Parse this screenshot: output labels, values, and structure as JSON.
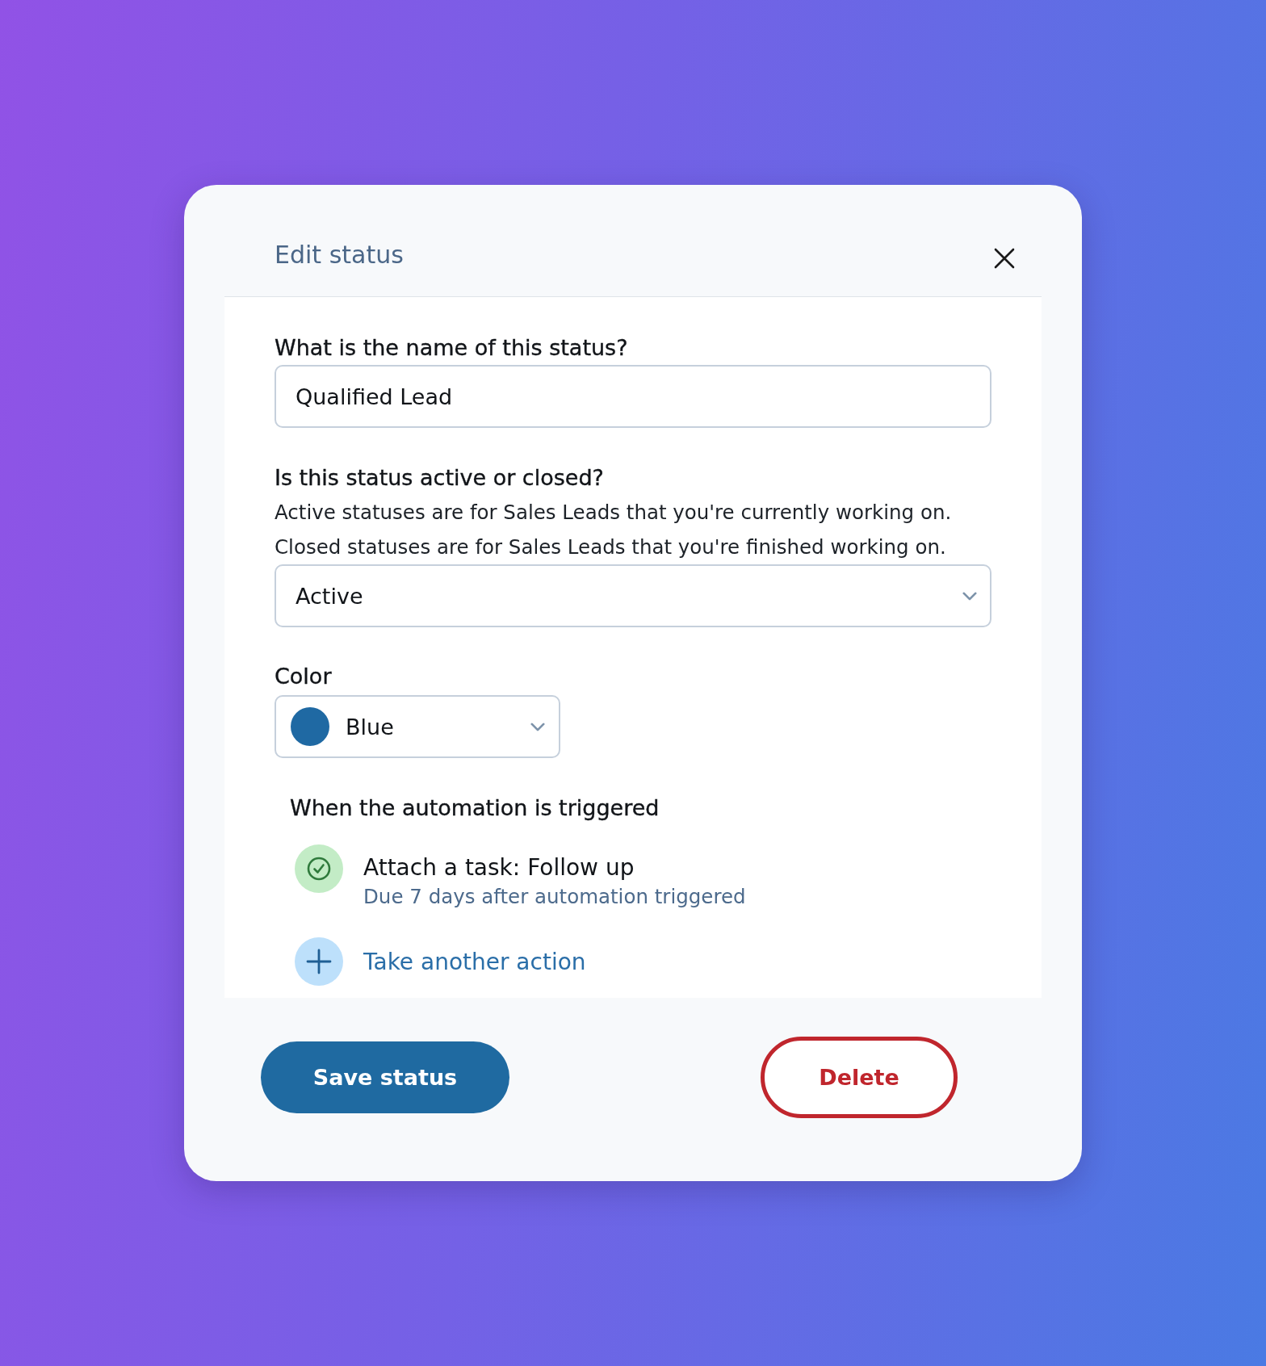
{
  "dialog": {
    "title": "Edit status"
  },
  "name_field": {
    "label": "What is the name of this status?",
    "value": "Qualified Lead"
  },
  "state_field": {
    "label": "Is this status active or closed?",
    "help": [
      "Active statuses are for Sales Leads that you're currently working on.",
      "Closed statuses are for Sales Leads that you're finished working on."
    ],
    "value": "Active"
  },
  "color_field": {
    "label": "Color",
    "value": "Blue",
    "color": "#1f69a3"
  },
  "automation": {
    "heading": "When the automation is triggered",
    "actions": [
      {
        "kind": "task",
        "title": "Attach a task: Follow up",
        "subtitle": "Due 7 days after automation triggered"
      },
      {
        "kind": "add",
        "title": "Take another action"
      }
    ]
  },
  "buttons": [
    {
      "kind": "primary",
      "label": "Save status"
    },
    {
      "kind": "danger",
      "label": "Delete"
    }
  ]
}
